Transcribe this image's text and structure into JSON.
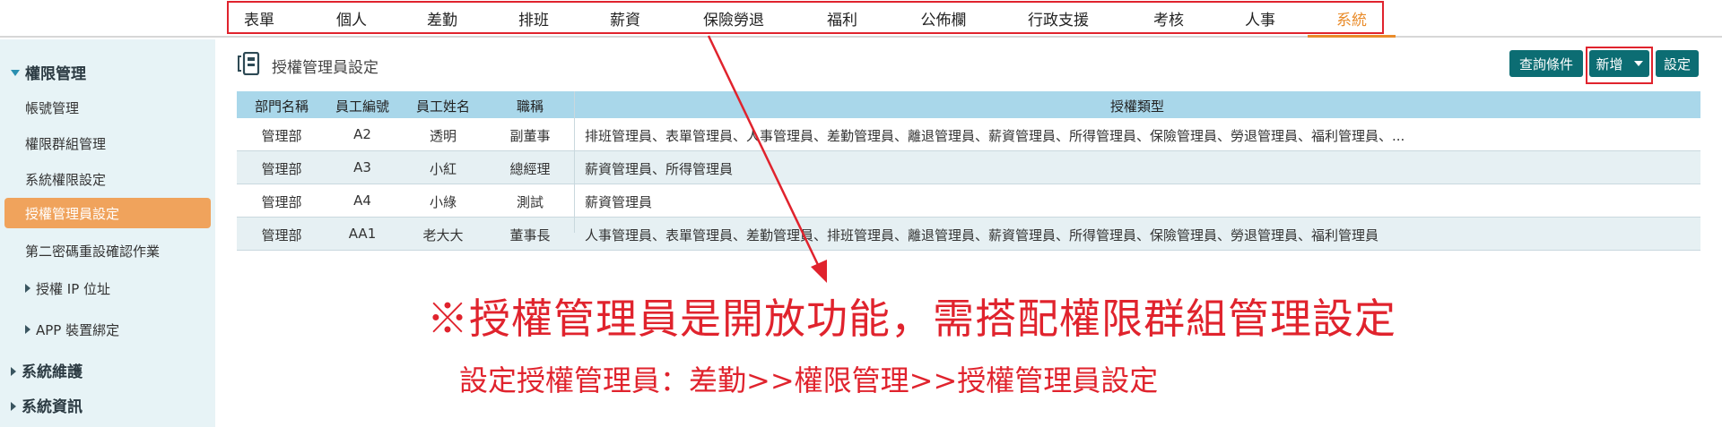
{
  "nav": {
    "items": [
      "表單",
      "個人",
      "差勤",
      "排班",
      "薪資",
      "保險勞退",
      "福利",
      "公佈欄",
      "行政支援",
      "考核",
      "人事",
      "系統"
    ],
    "active": "系統"
  },
  "sidebar": {
    "group_title": "權限管理",
    "items": [
      "帳號管理",
      "權限群組管理",
      "系統權限設定",
      "授權管理員設定",
      "第二密碼重設確認作業"
    ],
    "subgroups": [
      "授權 IP 位址",
      "APP 裝置綁定"
    ],
    "other_groups": [
      "系統維護",
      "系統資訊"
    ]
  },
  "page": {
    "title": "授權管理員設定",
    "buttons": {
      "query": "查詢條件",
      "add": "新增",
      "settings": "設定"
    }
  },
  "table": {
    "columns": [
      "部門名稱",
      "員工編號",
      "員工姓名",
      "職稱",
      "授權類型"
    ],
    "rows": [
      {
        "dept": "管理部",
        "emp_id": "A2",
        "name": "透明",
        "title": "副董事",
        "auth": "排班管理員、表單管理員、人事管理員、差勤管理員、離退管理員、薪資管理員、所得管理員、保險管理員、勞退管理員、福利管理員、..."
      },
      {
        "dept": "管理部",
        "emp_id": "A3",
        "name": "小紅",
        "title": "總經理",
        "auth": "薪資管理員、所得管理員"
      },
      {
        "dept": "管理部",
        "emp_id": "A4",
        "name": "小綠",
        "title": "測試",
        "auth": "薪資管理員"
      },
      {
        "dept": "管理部",
        "emp_id": "AA1",
        "name": "老大大",
        "title": "董事長",
        "auth": "人事管理員、表單管理員、差勤管理員、排班管理員、離退管理員、薪資管理員、所得管理員、保險管理員、勞退管理員、福利管理員"
      }
    ]
  },
  "annotation": {
    "main": "※授權管理員是開放功能，需搭配權限群組管理設定",
    "sub": "設定授權管理員：差勤>>權限管理>>授權管理員設定"
  },
  "colors": {
    "accent": "#e98b2a",
    "button": "#0c6d73",
    "highlight": "#e0232d",
    "header_bg": "#a9d7ea",
    "sidebar_bg": "#e7f3f6"
  }
}
